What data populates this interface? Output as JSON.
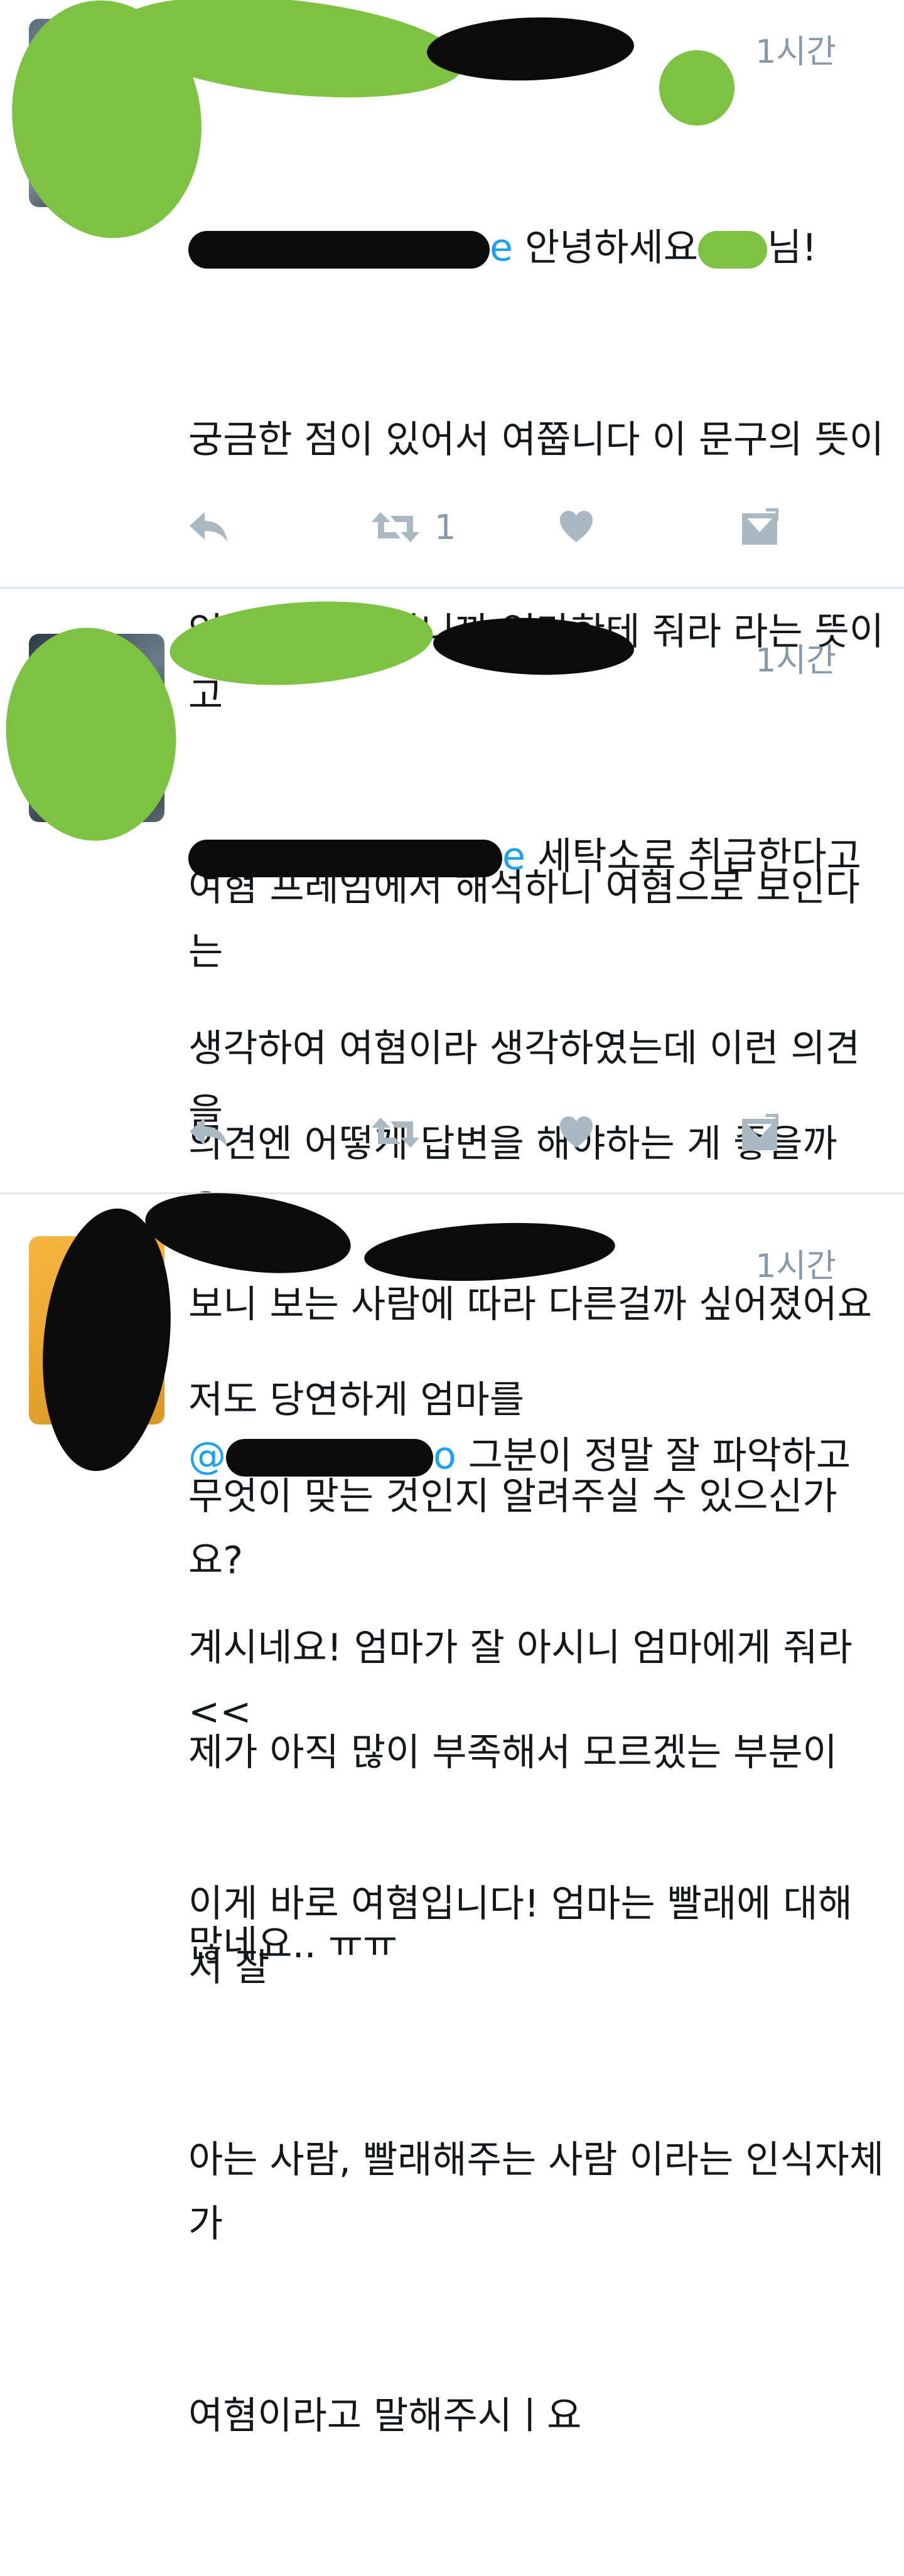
{
  "tweets": [
    {
      "time": "1시간",
      "mention_suffix": "e",
      "lines": [
        "안녕하세요",
        "궁금한 점이 있어서 여쭙니다 이 문구의 뜻이",
        "엄마가 잘 아시니까 엄마한테 줘라 라는 뜻이고",
        "여혐 프레임에서 해석하니 여혐으로 보인다는",
        "의견엔 어떻게 답변을 해야하는 게 좋을까요?",
        "저도 당연하게 엄마를"
      ],
      "first_line_tail": "님!",
      "actions": {
        "reply_icon": "reply-icon",
        "retweet_icon": "retweet-icon",
        "retweet_count": "1",
        "like_icon": "heart-icon",
        "dm_icon": "direct-message-icon"
      }
    },
    {
      "time": "1시간",
      "mention_suffix": "e",
      "lines": [
        "세탁소로 취급한다고",
        "생각하여 여혐이라 생각하였는데 이런 의견을",
        "보니 보는 사람에 따라 다른걸까 싶어졌어요",
        "무엇이 맞는 것인지 알려주실 수 있으신가요?",
        "제가 아직 많이 부족해서 모르겠는 부분이",
        "많네요.. ㅠㅠ"
      ],
      "actions": {
        "reply_icon": "reply-icon",
        "retweet_icon": "retweet-icon",
        "retweet_count": "",
        "like_icon": "heart-icon",
        "dm_icon": "direct-message-icon"
      }
    },
    {
      "time": "1시간",
      "mention_prefix": "@",
      "mention_suffix": "o",
      "lines": [
        "그분이 정말 잘 파악하고",
        "계시네요! 엄마가 잘 아시니 엄마에게 줘라 <<",
        "이게 바로 여혐입니다! 엄마는 빨래에 대해서 잘",
        "아는 사람, 빨래해주는 사람 이라는 인식자체가",
        "여혐이라고 말해주시ㅣ요"
      ]
    }
  ],
  "colors": {
    "mention": "#1da1f2",
    "muted": "#8899a6",
    "icon": "#aab8c2",
    "divider": "#e1e8ed",
    "redaction_green": "#7dc243",
    "redaction_black": "#0b0b0b"
  }
}
